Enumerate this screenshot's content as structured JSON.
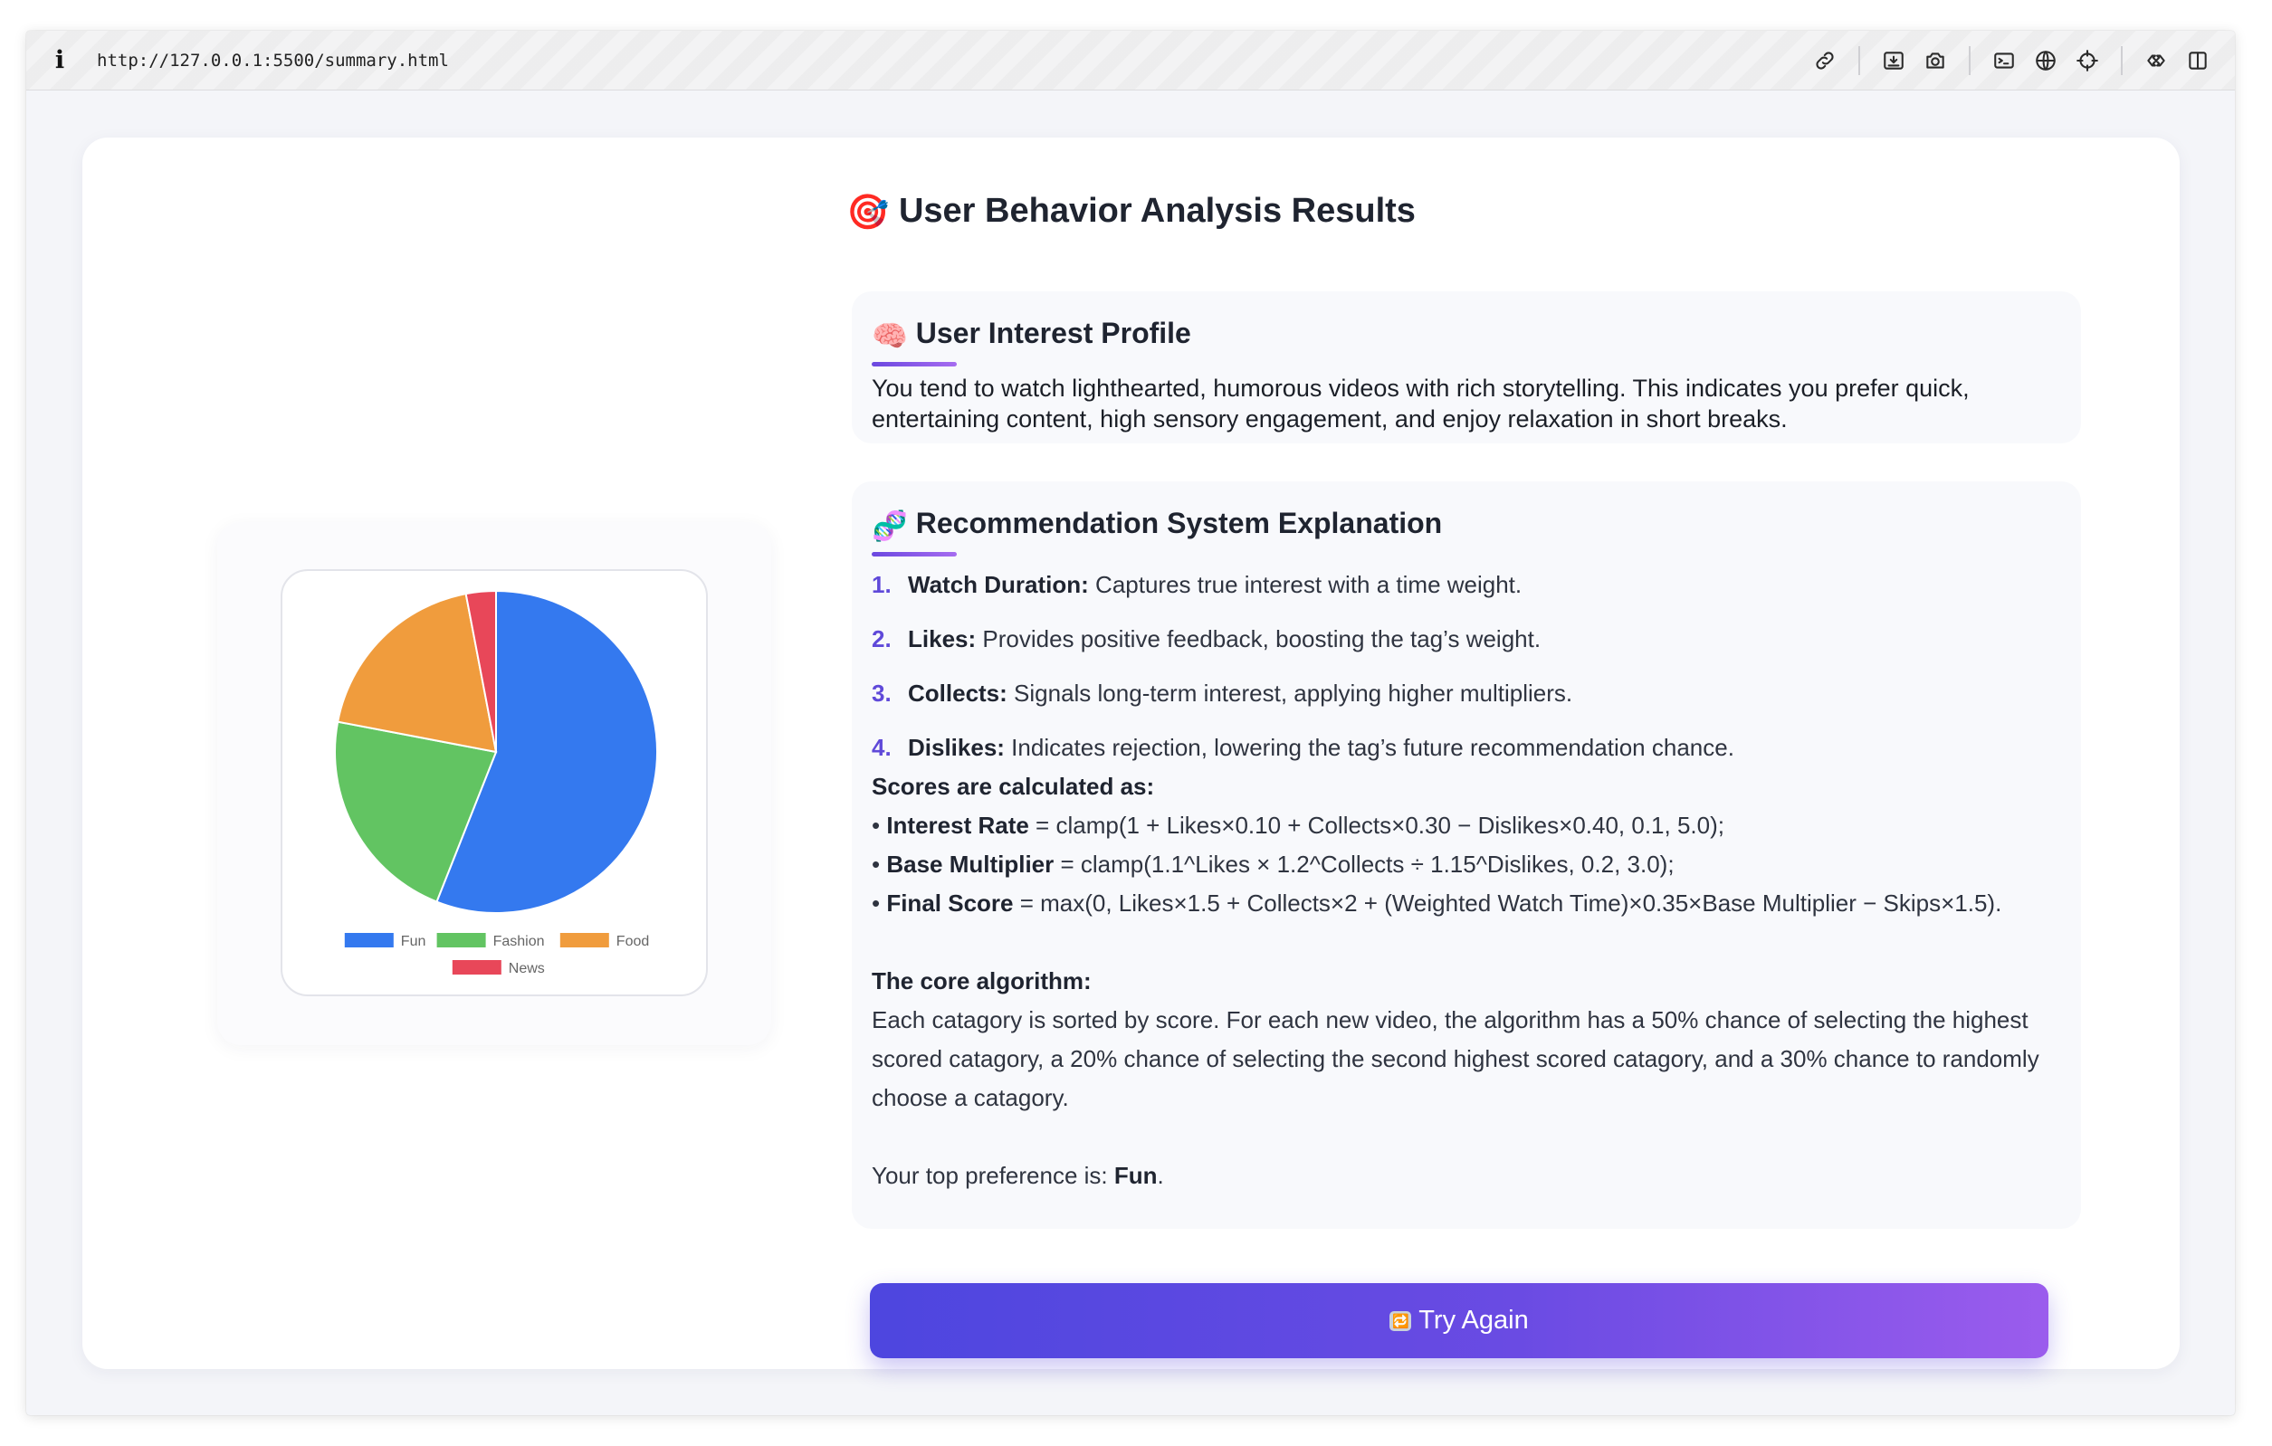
{
  "browser": {
    "url": "http://127.0.0.1:5500/summary.html",
    "toolbar_icons": [
      "link-icon",
      "download-icon",
      "camera-icon",
      "terminal-icon",
      "globe-icon",
      "crosshair-icon",
      "extensions-icon",
      "sidebar-icon"
    ]
  },
  "page": {
    "title_emoji": "🎯",
    "title": "User Behavior Analysis Results"
  },
  "profile": {
    "emoji": "🧠",
    "heading": "User Interest Profile",
    "text": "You tend to watch lighthearted, humorous videos with rich storytelling. This indicates you prefer quick, entertaining content, high sensory engagement, and enjoy relaxation in short breaks."
  },
  "explanation": {
    "emoji": "🧬",
    "heading": "Recommendation System Explanation",
    "items": [
      {
        "num": "1.",
        "label": "Watch Duration:",
        "text": " Captures true interest with a time weight."
      },
      {
        "num": "2.",
        "label": "Likes:",
        "text": " Provides positive feedback, boosting the tag’s weight."
      },
      {
        "num": "3.",
        "label": "Collects:",
        "text": " Signals long-term interest, applying higher multipliers."
      },
      {
        "num": "4.",
        "label": "Dislikes:",
        "text": " Indicates rejection, lowering the tag’s future recommendation chance."
      }
    ],
    "scores_heading": "Scores are calculated as:",
    "formulas": [
      {
        "bullet": "• ",
        "label": "Interest Rate",
        "text": " = clamp(1 + Likes×0.10 + Collects×0.30 − Dislikes×0.40, 0.1, 5.0);"
      },
      {
        "bullet": "• ",
        "label": "Base Multiplier",
        "text": " = clamp(1.1^Likes × 1.2^Collects ÷ 1.15^Dislikes, 0.2, 3.0);"
      },
      {
        "bullet": "• ",
        "label": "Final Score",
        "text": " = max(0, Likes×1.5 + Collects×2 + (Weighted Watch Time)×0.35×Base Multiplier − Skips×1.5)."
      }
    ],
    "core_heading": "The core algorithm:",
    "core_text": "Each catagory is sorted by score. For each new video, the algorithm has a 50% chance of selecting the highest scored catagory, a 20% chance of selecting the second highest scored catagory, and a 30% chance to randomly choose a catagory.",
    "top_pref_prefix": "Your top preference is: ",
    "top_pref_value": "Fun",
    "top_pref_suffix": "."
  },
  "button": {
    "icon": "🔁",
    "label": "Try Again"
  },
  "chart_data": {
    "type": "pie",
    "categories": [
      "Fun",
      "Fashion",
      "Food",
      "News"
    ],
    "values": [
      56,
      22,
      19,
      3
    ],
    "colors": [
      "#3479ef",
      "#62c462",
      "#f09c3d",
      "#e84759"
    ],
    "legend": "bottom",
    "title": ""
  }
}
